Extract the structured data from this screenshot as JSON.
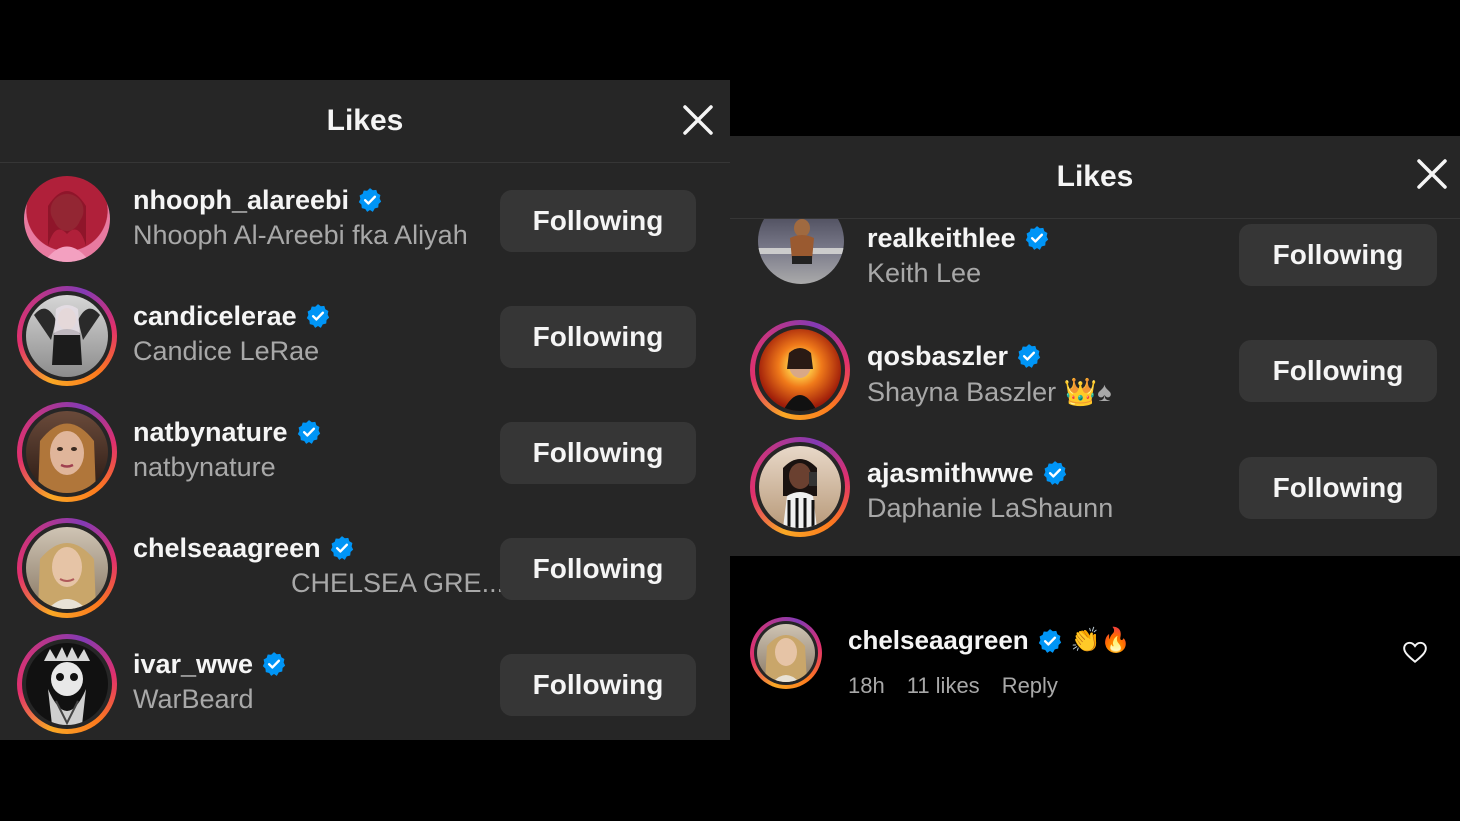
{
  "left_panel": {
    "title": "Likes",
    "users": [
      {
        "username": "nhooph_alareebi",
        "fullname": "Nhooph Al-Areebi fka Aliyah",
        "button": "Following",
        "ring": false
      },
      {
        "username": "candicelerae",
        "fullname": "Candice LeRae",
        "button": "Following",
        "ring": true
      },
      {
        "username": "natbynature",
        "fullname": "natbynature",
        "button": "Following",
        "ring": true
      },
      {
        "username": "chelseaagreen",
        "fullname": "CHELSEA GRE...",
        "button": "Following",
        "ring": true
      },
      {
        "username": "ivar_wwe",
        "fullname": "WarBeard",
        "button": "Following",
        "ring": true
      }
    ]
  },
  "right_panel": {
    "title": "Likes",
    "users": [
      {
        "username": "realkeithlee",
        "fullname": "Keith Lee",
        "button": "Following",
        "ring": false
      },
      {
        "username": "qosbaszler",
        "fullname": "Shayna Baszler 👑♠",
        "button": "Following",
        "ring": true
      },
      {
        "username": "ajasmithwwe",
        "fullname": "Daphanie LaShaunn",
        "button": "Following",
        "ring": true
      }
    ]
  },
  "comment": {
    "username": "chelseaagreen",
    "text": "👏🔥",
    "time": "18h",
    "likes": "11 likes",
    "reply": "Reply"
  },
  "colors": {
    "background": "#000000",
    "panel": "#262626",
    "button": "#363636",
    "verified": "#0095f6",
    "secondary_text": "#a8a8a8"
  }
}
